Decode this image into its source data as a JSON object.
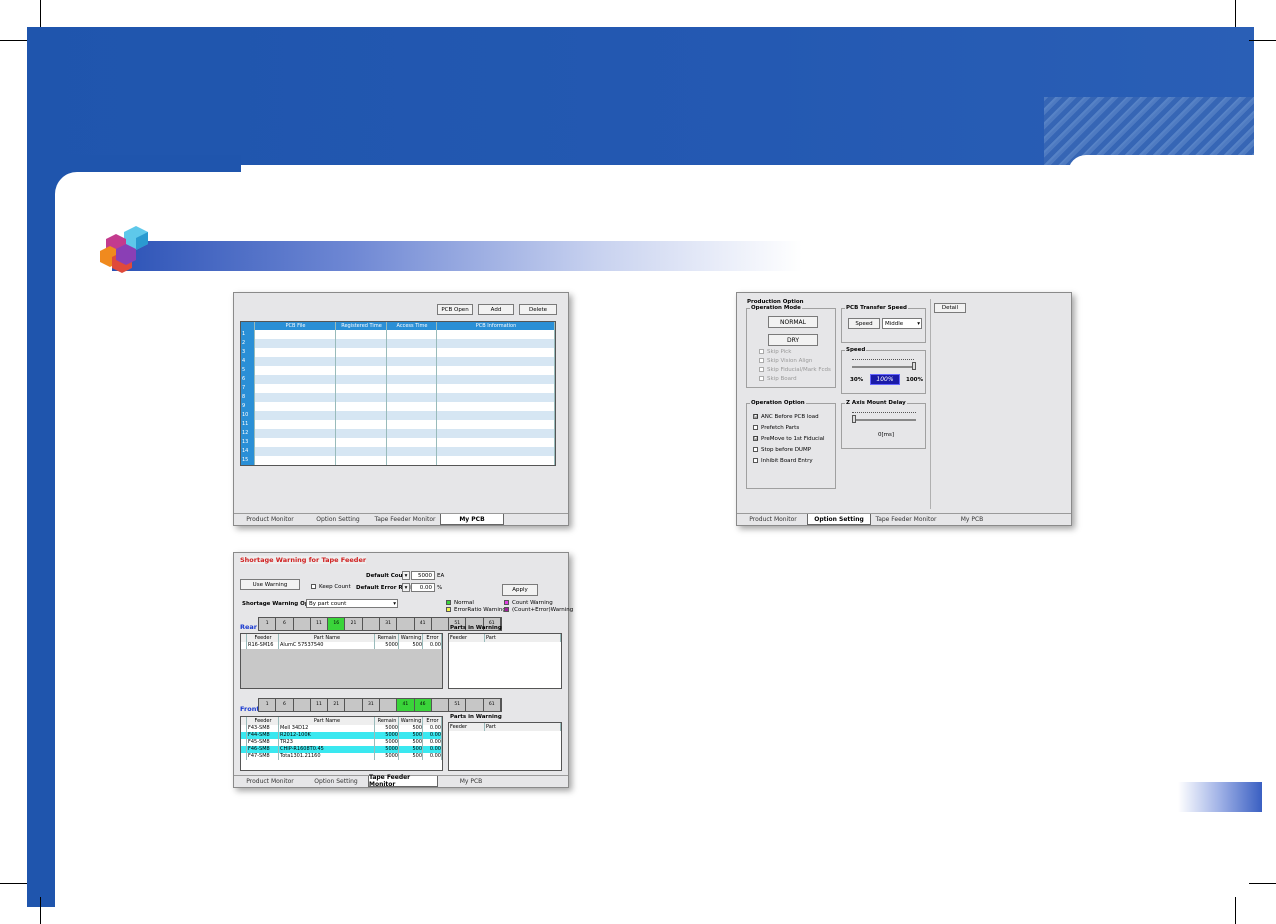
{
  "pcb_window": {
    "buttons": [
      "PCB Open",
      "Add",
      "Delete"
    ],
    "columns": [
      "",
      "PCB File",
      "Registered Time",
      "Access Time",
      "PCB Information"
    ],
    "rows": [
      "1",
      "2",
      "3",
      "4",
      "5",
      "6",
      "7",
      "8",
      "9",
      "10",
      "11",
      "12",
      "13",
      "14",
      "15"
    ],
    "tabs": [
      "Product Monitor",
      "Option Setting",
      "Tape Feeder Monitor",
      "My PCB"
    ]
  },
  "option_window": {
    "title": "Production Option",
    "operation_mode": {
      "title": "Operation Mode",
      "normal": "NORMAL",
      "dry": "DRY",
      "skips": [
        "Skip Pick",
        "Skip Vision Align",
        "Skip Fiducial/Mark Fcds",
        "Skip Board"
      ]
    },
    "transfer": {
      "title": "PCB Transfer Speed",
      "speed_label": "Speed",
      "speed_value": "Middle"
    },
    "detail": "Detail",
    "speed": {
      "title": "Speed",
      "min": "30%",
      "value": "100%",
      "max": "100%"
    },
    "operation_option": {
      "title": "Operation Option",
      "items": [
        {
          "label": "ANC Before PCB load",
          "checked": "☑"
        },
        {
          "label": "Prefetch Parts",
          "checked": "☐"
        },
        {
          "label": "PreMove to 1st Fiducial",
          "checked": "☑"
        },
        {
          "label": "Stop before DUMP",
          "checked": "☐"
        },
        {
          "label": "Inhibit Board Entry",
          "checked": "☐"
        }
      ]
    },
    "zaxis": {
      "title": "Z Axis Mount Delay",
      "value": "0[ms]"
    },
    "tabs": [
      "Product Monitor",
      "Option Setting",
      "Tape Feeder Monitor",
      "My PCB"
    ]
  },
  "tape_window": {
    "title": "Shortage Warning for Tape Feeder",
    "use_warning": "Use Warning",
    "keep_count": "Keep Count",
    "default_count_label": "Default Count",
    "default_count": "5000",
    "default_count_unit": "EA",
    "default_error_label": "Default Error Ratio",
    "default_error": "0.00",
    "default_error_unit": "%",
    "apply": "Apply",
    "option_label": "Shortage Warning Option:",
    "option_value": "By part count",
    "legend": [
      {
        "label": "Normal",
        "color": "#3ad43a"
      },
      {
        "label": "Count Warning",
        "color": "#e040e0"
      },
      {
        "label": "ErrorRatio Warning",
        "color": "#f2f24a"
      },
      {
        "label": "(Count+Error)Warning",
        "color": "#a0209a"
      }
    ],
    "rear_label": "Rear",
    "front_label": "Front",
    "rear_strip": [
      "1",
      "6",
      "",
      "11",
      "16",
      "21",
      "",
      "31",
      "",
      "41",
      "",
      "51",
      "",
      "61"
    ],
    "front_strip": [
      "1",
      "6",
      "",
      "11",
      "21",
      "",
      "31",
      "",
      "41",
      "46",
      "",
      "51",
      "",
      "61"
    ],
    "columns": [
      "Feeder",
      "Part Name",
      "Remain",
      "Warning",
      "Error"
    ],
    "rear_rows": [
      {
        "feeder": "R16-SM16",
        "part": "AlumC 57537540",
        "remain": "5000",
        "warning": "500",
        "error": "0.00"
      }
    ],
    "front_rows": [
      {
        "feeder": "F43-SM8",
        "part": "Mell 34D12",
        "remain": "5000",
        "warning": "500",
        "error": "0.00"
      },
      {
        "feeder": "F44-SM8",
        "part": "R2012-100K",
        "remain": "5000",
        "warning": "500",
        "error": "0.00"
      },
      {
        "feeder": "F45-SM8",
        "part": "TR23",
        "remain": "5000",
        "warning": "500",
        "error": "0.00"
      },
      {
        "feeder": "F46-SM8",
        "part": "CHIP-R1608T0.45",
        "remain": "5000",
        "warning": "500",
        "error": "0.00"
      },
      {
        "feeder": "F47-SM8",
        "part": "Tota1301.21160",
        "remain": "5000",
        "warning": "500",
        "error": "0.00"
      }
    ],
    "parts_in_warning": "Parts in Warning",
    "piw_columns": [
      "Feeder",
      "Part"
    ],
    "tabs": [
      "Product Monitor",
      "Option Setting",
      "Tape Feeder Monitor",
      "My PCB"
    ]
  }
}
